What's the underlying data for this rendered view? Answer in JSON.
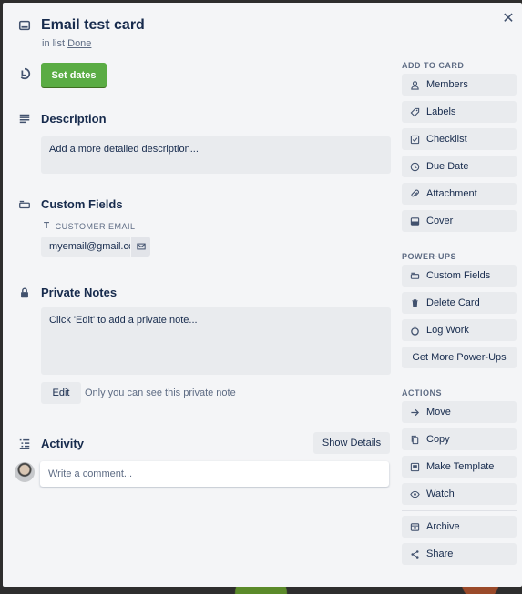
{
  "card": {
    "title": "Email test card",
    "list_prefix": "in list",
    "list_name": "Done"
  },
  "dates_button": "Set dates",
  "description": {
    "heading": "Description",
    "placeholder": "Add a more detailed description..."
  },
  "custom_fields": {
    "heading": "Custom Fields",
    "field_label": "CUSTOMER EMAIL",
    "field_value": "myemail@gmail.com"
  },
  "private_notes": {
    "heading": "Private Notes",
    "placeholder": "Click 'Edit' to add a private note...",
    "edit_button": "Edit",
    "note": "Only you can see this private note"
  },
  "activity": {
    "heading": "Activity",
    "show_details": "Show Details",
    "comment_placeholder": "Write a comment..."
  },
  "sidebar": {
    "add_to_card_heading": "ADD TO CARD",
    "add_to_card": [
      {
        "label": "Members",
        "icon": "person-icon"
      },
      {
        "label": "Labels",
        "icon": "label-icon"
      },
      {
        "label": "Checklist",
        "icon": "checklist-icon"
      },
      {
        "label": "Due Date",
        "icon": "clock-icon"
      },
      {
        "label": "Attachment",
        "icon": "paperclip-icon"
      },
      {
        "label": "Cover",
        "icon": "cover-icon"
      }
    ],
    "powerups_heading": "POWER-UPS",
    "powerups": [
      {
        "label": "Custom Fields",
        "icon": "custom-fields-icon"
      },
      {
        "label": "Delete Card",
        "icon": "trash-icon"
      },
      {
        "label": "Log Work",
        "icon": "stopwatch-icon"
      },
      {
        "label": "Get More Power-Ups",
        "icon": ""
      }
    ],
    "actions_heading": "ACTIONS",
    "actions": [
      {
        "label": "Move",
        "icon": "arrow-right-icon"
      },
      {
        "label": "Copy",
        "icon": "copy-icon"
      },
      {
        "label": "Make Template",
        "icon": "template-icon"
      },
      {
        "label": "Watch",
        "icon": "eye-icon"
      }
    ],
    "extra": [
      {
        "label": "Archive",
        "icon": "archive-icon"
      },
      {
        "label": "Share",
        "icon": "share-icon"
      }
    ]
  },
  "colors": {
    "accent_green": "#5aac44",
    "panel_bg": "#f4f5f7",
    "button_bg": "#e9ebee",
    "text": "#172b4d",
    "muted": "#5e6c84"
  }
}
